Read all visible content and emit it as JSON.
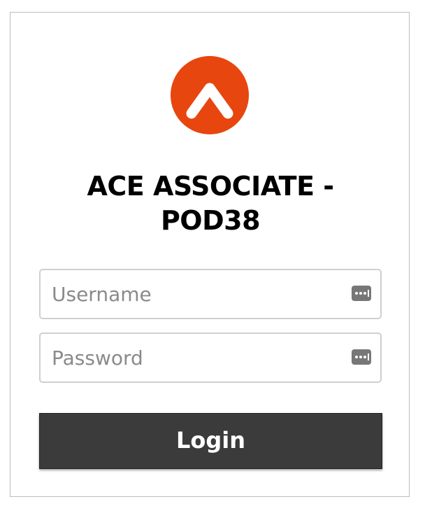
{
  "logo": {
    "icon": "caret-up-logo-icon",
    "color": "#e8460f"
  },
  "title": {
    "line1": "ACE ASSOCIATE -",
    "line2": "POD38"
  },
  "username": {
    "placeholder": "Username",
    "value": "",
    "icon": "password-manager-icon"
  },
  "password": {
    "placeholder": "Password",
    "value": "",
    "icon": "password-manager-icon"
  },
  "login_button": {
    "label": "Login",
    "color": "#3b3b3b"
  }
}
